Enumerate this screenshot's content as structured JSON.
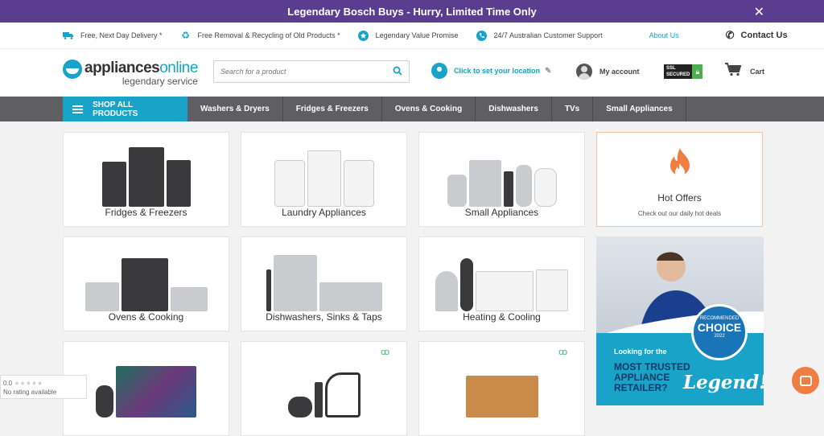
{
  "promo_bar": {
    "text": "Legendary Bosch Buys - Hurry, Limited Time Only",
    "close": "✕"
  },
  "usp": {
    "items": [
      {
        "icon": "truck-icon",
        "text": "Free, Next Day Delivery *"
      },
      {
        "icon": "recycle-icon",
        "text": "Free Removal & Recycling of Old Products *"
      },
      {
        "icon": "star-icon",
        "text": "Legendary Value Promise"
      },
      {
        "icon": "phone-icon",
        "text": "24/7 Australian Customer Support"
      }
    ],
    "about": "About Us",
    "contact": "Contact Us"
  },
  "header": {
    "logo_name_a": "appliances",
    "logo_name_b": "online",
    "logo_tag": "legendary service",
    "search_placeholder": "Search for a product",
    "location": "Click to set your location",
    "account": "My account",
    "ssl_line1": "SSL",
    "ssl_line2": "SECURED",
    "cart": "Cart"
  },
  "nav": {
    "shop_all": "SHOP ALL PRODUCTS",
    "items": [
      "Washers & Dryers",
      "Fridges & Freezers",
      "Ovens & Cooking",
      "Dishwashers",
      "TVs",
      "Small Appliances"
    ]
  },
  "tiles": {
    "fridges": "Fridges & Freezers",
    "laundry": "Laundry Appliances",
    "small": "Small Appliances",
    "hot_title": "Hot Offers",
    "hot_sub": "Check out our daily hot deals",
    "ovens": "Ovens & Cooking",
    "dishwashers": "Dishwashers, Sinks & Taps",
    "heating": "Heating & Cooling"
  },
  "promo_tile": {
    "look": "Looking for the",
    "most_1": "MOST TRUSTED",
    "most_2": "APPLIANCE",
    "most_3": "RETAILER?",
    "legend": "Legend!",
    "badge_top": "RECOMMENDED",
    "badge_main": "CHOICE",
    "badge_year": "2022"
  },
  "rating": {
    "score": "0.0",
    "stars": "★★★★★",
    "text": "No rating available"
  },
  "colors": {
    "brand": "#1aa3c9",
    "promo": "#5b3d8f",
    "nav": "#5e5e63",
    "hot": "#f07e42"
  }
}
